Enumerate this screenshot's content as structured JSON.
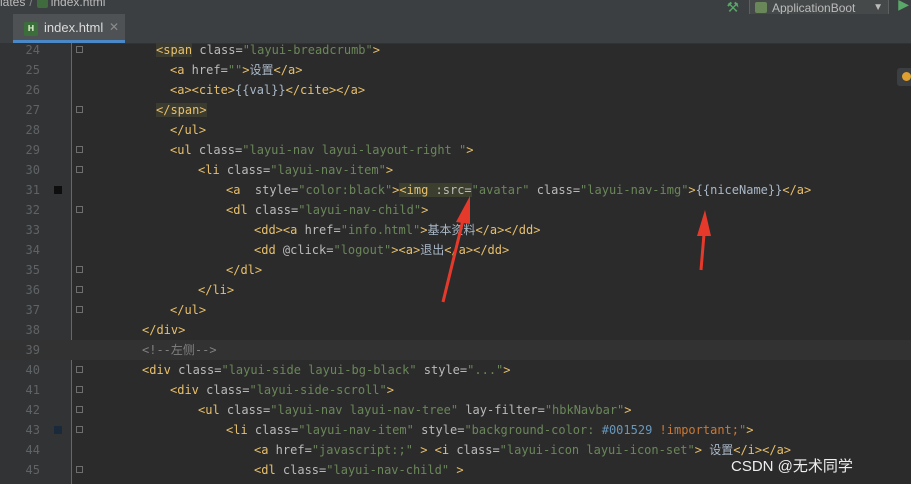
{
  "breadcrumb": {
    "folder": "lates",
    "file": "index.html"
  },
  "toolbar": {
    "run_config": "ApplicationBoot"
  },
  "tab": {
    "label": "index.html",
    "icon_text": "H"
  },
  "lines": [
    {
      "n": "24",
      "indent": 84,
      "tokens": [
        [
          "t",
          "<span"
        ],
        [
          "a",
          " class="
        ],
        [
          "v",
          "\"layui-breadcrumb\""
        ],
        [
          "t",
          ">"
        ]
      ]
    },
    {
      "n": "25",
      "indent": 98,
      "tokens": [
        [
          "t",
          "<a"
        ],
        [
          "a",
          " href="
        ],
        [
          "v",
          "\"\""
        ],
        [
          "t",
          ">"
        ],
        [
          "txt",
          "设置"
        ],
        [
          "t",
          "</a>"
        ]
      ]
    },
    {
      "n": "26",
      "indent": 98,
      "tokens": [
        [
          "t",
          "<a><cite>"
        ],
        [
          "txt",
          "{{val}}"
        ],
        [
          "t",
          "</cite></a>"
        ]
      ]
    },
    {
      "n": "27",
      "indent": 84,
      "tokens": [
        [
          "t",
          "</span>"
        ]
      ]
    },
    {
      "n": "28",
      "indent": 98,
      "tokens": [
        [
          "t",
          "</ul>"
        ]
      ]
    },
    {
      "n": "29",
      "indent": 98,
      "tokens": [
        [
          "t",
          "<ul"
        ],
        [
          "a",
          " class="
        ],
        [
          "v",
          "\"layui-nav layui-layout-right \""
        ],
        [
          "t",
          ">"
        ]
      ]
    },
    {
      "n": "30",
      "indent": 126,
      "tokens": [
        [
          "t",
          "<li"
        ],
        [
          "a",
          " class="
        ],
        [
          "v",
          "\"layui-nav-item\""
        ],
        [
          "t",
          ">"
        ]
      ]
    },
    {
      "n": "31",
      "indent": 154,
      "tokens": [
        [
          "t",
          "<a"
        ],
        [
          "a",
          "  style="
        ],
        [
          "v",
          "\"color:black\""
        ],
        [
          "t",
          ">"
        ],
        [
          "t",
          "<img"
        ],
        [
          "a",
          " :src="
        ],
        [
          "v",
          "\"avatar\""
        ],
        [
          "a",
          " class="
        ],
        [
          "v",
          "\"layui-nav-img\""
        ],
        [
          "t",
          ">"
        ],
        [
          "txt",
          "{{niceName}}"
        ],
        [
          "t",
          "</a>"
        ]
      ]
    },
    {
      "n": "32",
      "indent": 154,
      "tokens": [
        [
          "t",
          "<dl"
        ],
        [
          "a",
          " class="
        ],
        [
          "v",
          "\"layui-nav-child\""
        ],
        [
          "t",
          ">"
        ]
      ]
    },
    {
      "n": "33",
      "indent": 182,
      "tokens": [
        [
          "t",
          "<dd><a"
        ],
        [
          "a",
          " href="
        ],
        [
          "v",
          "\"info.html\""
        ],
        [
          "t",
          ">"
        ],
        [
          "txt",
          "基本资料"
        ],
        [
          "t",
          "</a></dd>"
        ]
      ]
    },
    {
      "n": "34",
      "indent": 182,
      "tokens": [
        [
          "t",
          "<dd"
        ],
        [
          "a",
          " @click="
        ],
        [
          "v",
          "\"logout\""
        ],
        [
          "t",
          "><a>"
        ],
        [
          "txt",
          "退出"
        ],
        [
          "t",
          "</a></dd>"
        ]
      ]
    },
    {
      "n": "35",
      "indent": 154,
      "tokens": [
        [
          "t",
          "</dl>"
        ]
      ]
    },
    {
      "n": "36",
      "indent": 126,
      "tokens": [
        [
          "t",
          "</li>"
        ]
      ]
    },
    {
      "n": "37",
      "indent": 98,
      "tokens": [
        [
          "t",
          "</ul>"
        ]
      ]
    },
    {
      "n": "38",
      "indent": 70,
      "tokens": [
        [
          "t",
          "</div>"
        ]
      ]
    },
    {
      "n": "39",
      "indent": 70,
      "tokens": [
        [
          "c",
          "<!--左侧-->"
        ]
      ]
    },
    {
      "n": "40",
      "indent": 70,
      "tokens": [
        [
          "t",
          "<div"
        ],
        [
          "a",
          " class="
        ],
        [
          "v",
          "\"layui-side layui-bg-black\""
        ],
        [
          "a",
          " style="
        ],
        [
          "v",
          "\"...\""
        ],
        [
          "t",
          ">"
        ]
      ]
    },
    {
      "n": "41",
      "indent": 98,
      "tokens": [
        [
          "t",
          "<div"
        ],
        [
          "a",
          " class="
        ],
        [
          "v",
          "\"layui-side-scroll\""
        ],
        [
          "t",
          ">"
        ]
      ]
    },
    {
      "n": "42",
      "indent": 126,
      "tokens": [
        [
          "t",
          "<ul"
        ],
        [
          "a",
          " class="
        ],
        [
          "v",
          "\"layui-nav layui-nav-tree\""
        ],
        [
          "a",
          " lay-filter="
        ],
        [
          "v",
          "\"hbkNavbar\""
        ],
        [
          "t",
          ">"
        ]
      ]
    },
    {
      "n": "43",
      "indent": 154,
      "tokens": [
        [
          "t",
          "<li"
        ],
        [
          "a",
          " class="
        ],
        [
          "v",
          "\"layui-nav-item\""
        ],
        [
          "a",
          " style="
        ],
        [
          "v",
          "\"background-color: "
        ],
        [
          "num",
          "#001529"
        ],
        [
          "k",
          " !important;"
        ],
        [
          "v",
          "\""
        ],
        [
          "t",
          ">"
        ]
      ]
    },
    {
      "n": "44",
      "indent": 182,
      "tokens": [
        [
          "t",
          "<a"
        ],
        [
          "a",
          " href="
        ],
        [
          "v",
          "\"javascript:;\""
        ],
        [
          "t",
          " > <i"
        ],
        [
          "a",
          " class="
        ],
        [
          "v",
          "\"layui-icon layui-icon-set\""
        ],
        [
          "t",
          ">"
        ],
        [
          "txt",
          " 设置"
        ],
        [
          "t",
          "</i></a>"
        ]
      ]
    },
    {
      "n": "45",
      "indent": 182,
      "tokens": [
        [
          "t",
          "<dl"
        ],
        [
          "a",
          " class="
        ],
        [
          "v",
          "\"layui-nav-child\""
        ],
        [
          "t",
          " >"
        ]
      ]
    }
  ],
  "watermark": "CSDN @无术同学"
}
